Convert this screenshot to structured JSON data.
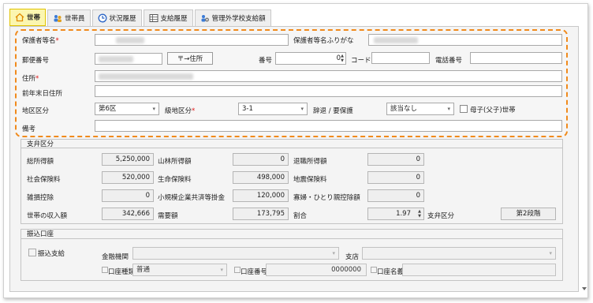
{
  "tabs": [
    {
      "label": "世帯",
      "icon": "house-icon",
      "active": true
    },
    {
      "label": "世帯員",
      "icon": "people-icon",
      "active": false
    },
    {
      "label": "状況履歴",
      "icon": "clock-icon",
      "active": false
    },
    {
      "label": "支給履歴",
      "icon": "table-icon",
      "active": false
    },
    {
      "label": "管理外学校支給額",
      "icon": "users-gear-icon",
      "active": false
    }
  ],
  "household": {
    "guardian_name_label": "保護者等名",
    "guardian_kana_label": "保護者等名ふりがな",
    "postal_label": "郵便番号",
    "postal_button": "〒→住所",
    "number_label": "番号",
    "number_value": "0",
    "code_label": "コード",
    "phone_label": "電話番号",
    "address_label": "住所",
    "prev_address_label": "前年末日住所",
    "district_label": "地区区分",
    "district_value": "第6区",
    "grade_label": "級地区分",
    "grade_value": "3-1",
    "decline_label": "辞退 / 要保護",
    "decline_value": "該当なし",
    "single_parent_label": "母子(父子)世帯",
    "note_label": "備考",
    "required_mark": "*"
  },
  "payment": {
    "title": "支弁区分",
    "total_income_label": "総所得額",
    "total_income": "5,250,000",
    "forest_income_label": "山林所得額",
    "forest_income": "0",
    "retire_income_label": "退職所得額",
    "retire_income": "0",
    "social_ins_label": "社会保険料",
    "social_ins": "520,000",
    "life_ins_label": "生命保険料",
    "life_ins": "498,000",
    "quake_ins_label": "地震保険料",
    "quake_ins": "0",
    "misc_ded_label": "雑損控除",
    "misc_ded": "0",
    "small_biz_label": "小規模企業共済等掛金",
    "small_biz": "120,000",
    "widow_label": "寡婦・ひとり親控除額",
    "widow": "0",
    "household_income_label": "世帯の収入額",
    "household_income": "342,666",
    "demand_label": "需要額",
    "demand": "173,795",
    "ratio_label": "割合",
    "ratio": "1.97",
    "category_label": "支弁区分",
    "category": "第2段階"
  },
  "transfer": {
    "title": "振込口座",
    "transfer_pay_label": "振込支給",
    "bank_label": "金融機関",
    "branch_label": "支店",
    "account_type_label": "口座種類",
    "account_type_value": "普通",
    "account_no_label": "口座番号",
    "account_no_value": "0000000",
    "account_name_label": "口座名義"
  },
  "colors": {
    "highlight_border": "#f08a1c",
    "active_tab_bg": "#fbf6b0",
    "required": "#e01515"
  }
}
